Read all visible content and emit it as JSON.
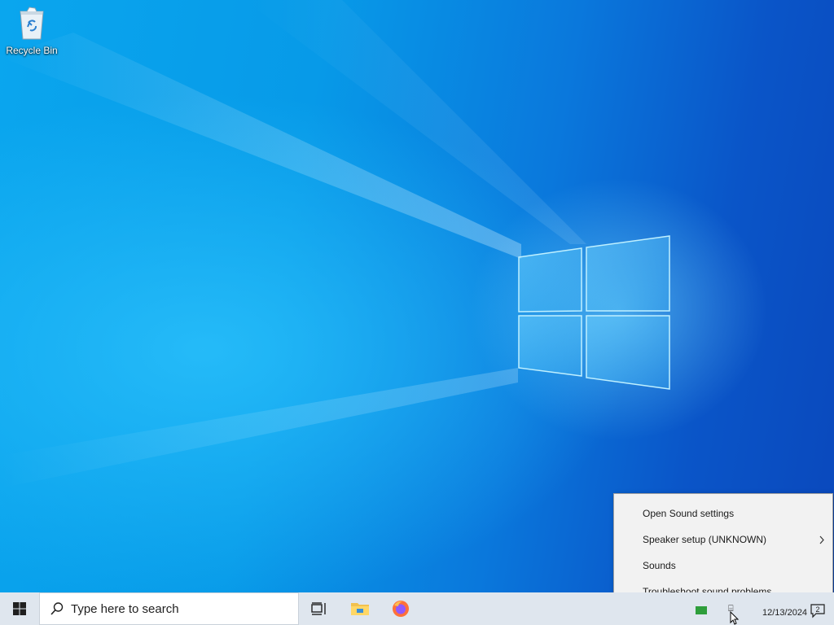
{
  "desktop": {
    "icons": [
      {
        "label": "Recycle Bin",
        "icon": "recycle-bin-icon"
      }
    ]
  },
  "taskbar": {
    "start_icon": "windows-logo-icon",
    "search": {
      "placeholder": "Type here to search",
      "icon": "search-icon"
    },
    "task_view_icon": "task-view-icon",
    "pinned_apps": [
      {
        "icon": "file-explorer-icon"
      },
      {
        "icon": "firefox-icon"
      }
    ],
    "tray": {
      "date": "12/13/2024",
      "notification_count": "2"
    }
  },
  "context_menu": {
    "items": [
      {
        "label": "Open Sound settings",
        "has_submenu": false
      },
      {
        "label": "Speaker setup (UNKNOWN)",
        "has_submenu": true
      },
      {
        "label": "Sounds",
        "has_submenu": false
      },
      {
        "label": "Troubleshoot sound problems",
        "has_submenu": false
      }
    ]
  },
  "colors": {
    "taskbar_bg": "#dfe6ee",
    "menu_bg": "#f2f2f2",
    "wallpaper_accent": "#0a78dc"
  }
}
